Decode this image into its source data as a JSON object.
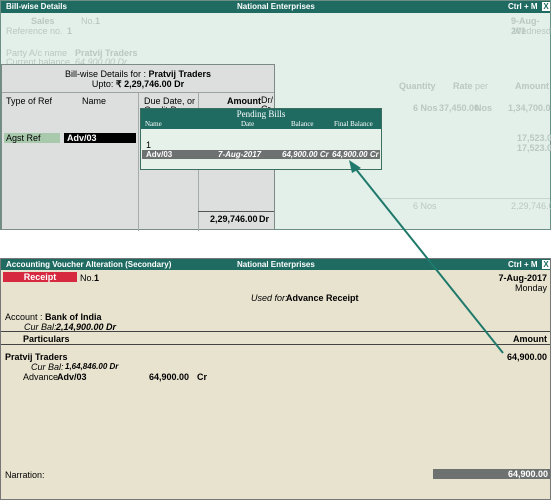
{
  "top": {
    "title": "Bill-wise Details",
    "company": "National Enterprises",
    "shortcut": "Ctrl + M",
    "close": "X",
    "bg": {
      "sales": "Sales",
      "no_label": "No.",
      "no_value": "1",
      "date": "9-Aug-201",
      "ref_label": "Reference no.",
      "ref_value": "1",
      "day": "Wednesda",
      "party_label": "Party A/c name",
      "party_value": "Pratvij Traders",
      "cur_bal_label": "Current balance",
      "cur_bal_value": "64,900.00 Dr",
      "quantity": "Quantity",
      "rate": "Rate",
      "per": "per",
      "amount": "Amount",
      "row_qty": "6 Nos",
      "row_rate": "37,450.00",
      "row_per": "Nos",
      "row_amount": "1,34,700.0",
      "tax1": "17,523.0",
      "tax2": "17,523.0",
      "total_qty": "6 Nos",
      "total_amount": "2,29,746.0"
    }
  },
  "billwise": {
    "for_label": "Bill-wise Details for :",
    "party": "Pratvij Traders",
    "upto_label": "Upto:",
    "upto_value": "₹ 2,29,746.00 Dr",
    "col_type": "Type of Ref",
    "col_name": "Name",
    "col_due": "Due Date, or",
    "col_due2": "Credit Days",
    "col_amount": "Amount",
    "col_drcr": "Dr/ Cr",
    "row_type": "Agst Ref",
    "row_name": "Adv/03",
    "total": "2,29,746.00",
    "total_drcr": "Dr"
  },
  "pending": {
    "title": "Pending Bills",
    "col_name": "Name",
    "col_date": "Date",
    "col_balance": "Balance",
    "col_final": "Final Balance",
    "count": "1",
    "row_name": "Adv/03",
    "row_date": "7-Aug-2017",
    "row_balance": "64,900.00 Cr",
    "row_final": "64,900.00 Cr"
  },
  "voucher": {
    "title": "Accounting Voucher  Alteration  (Secondary)",
    "company": "National Enterprises",
    "shortcut": "Ctrl + M",
    "close": "X",
    "type": "Receipt",
    "no_label": "No.",
    "no_value": "1",
    "date": "7-Aug-2017",
    "day": "Monday",
    "used_for_label": "Used for:",
    "used_for_value": "Advance Receipt",
    "account_label": "Account :",
    "account_value": "Bank of India",
    "acc_bal_label": "Cur Bal:",
    "acc_bal_value": "2,14,900.00 Dr",
    "col_particulars": "Particulars",
    "col_amount": "Amount",
    "party": "Pratvij Traders",
    "party_amount": "64,900.00",
    "party_bal_label": "Cur Bal:",
    "party_bal_value": "1,64,846.00 Dr",
    "adv_label": "Advance",
    "adv_ref": "Adv/03",
    "adv_amount": "64,900.00",
    "adv_drcr": "Cr",
    "narration_label": "Narration:",
    "total": "64,900.00"
  },
  "colors": {
    "title_bar": "#1f6b62",
    "receipt_badge": "#d6283f",
    "arrow": "#1f7a6c"
  }
}
